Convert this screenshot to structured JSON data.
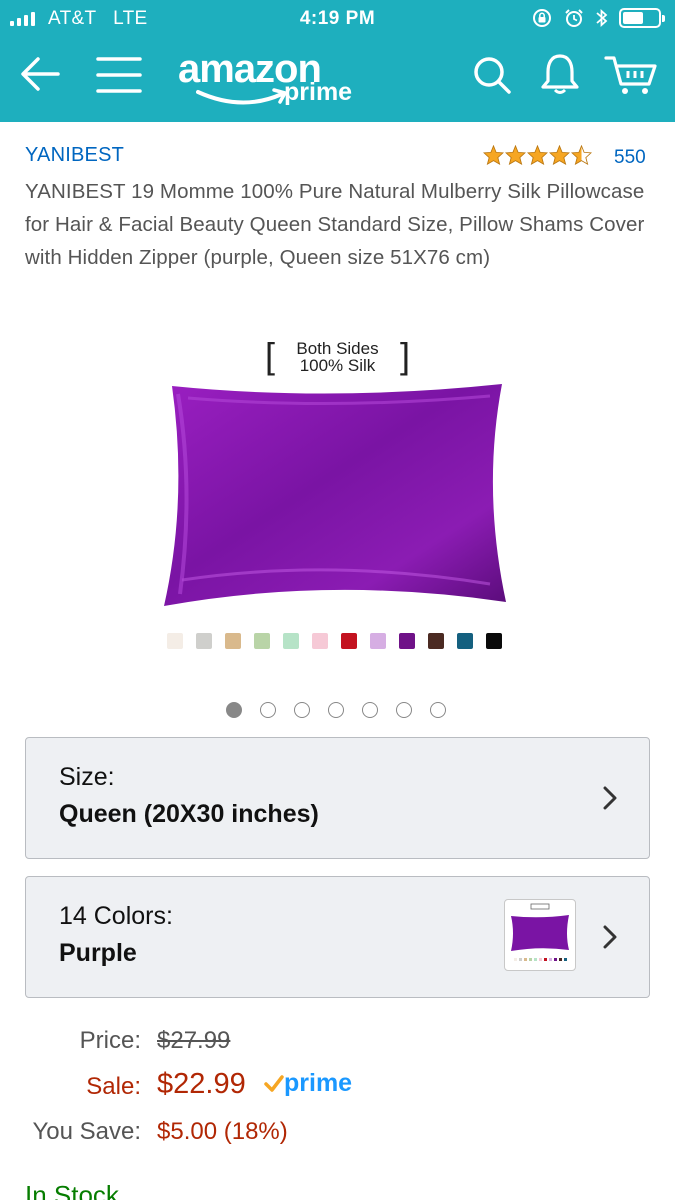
{
  "status_bar": {
    "carrier": "AT&T",
    "network": "LTE",
    "time": "4:19 PM"
  },
  "header": {
    "logo_word": "amazon",
    "logo_sub": "prime",
    "accent_color": "#1eafbe",
    "icons": [
      "back-arrow-icon",
      "menu-icon",
      "search-icon",
      "bell-icon",
      "cart-icon"
    ]
  },
  "product": {
    "brand": "YANIBEST",
    "rating": 4.5,
    "review_count": "550",
    "title": "YANIBEST 19 Momme 100% Pure Natural Mulberry Silk Pillowcase for Hair & Facial Beauty Queen Standard Size, Pillow Shams Cover with Hidden Zipper (purple, Queen size 51X76 cm)"
  },
  "image": {
    "label_line1": "Both Sides",
    "label_line2": "100% Silk",
    "pillow_color": "#7a1aa0",
    "swatch_colors": [
      "#f4ede6",
      "#cfcfcc",
      "#d9b98c",
      "#b9d4a7",
      "#b6e3c7",
      "#f6c9d6",
      "#c3121f",
      "#d6aee3",
      "#6f1288",
      "#4b2a22",
      "#14607f",
      "#0a0a0a"
    ],
    "carousel_count": 7,
    "carousel_active": 0
  },
  "selectors": {
    "size": {
      "label": "Size:",
      "value": "Queen (20X30 inches)"
    },
    "color": {
      "label": "14 Colors:",
      "value": "Purple"
    }
  },
  "pricing": {
    "price_label": "Price:",
    "list_price": "$27.99",
    "sale_label": "Sale:",
    "sale_price": "$22.99",
    "prime_label": "prime",
    "save_label": "You Save:",
    "save_value": "$5.00 (18%)",
    "availability": "In Stock"
  }
}
